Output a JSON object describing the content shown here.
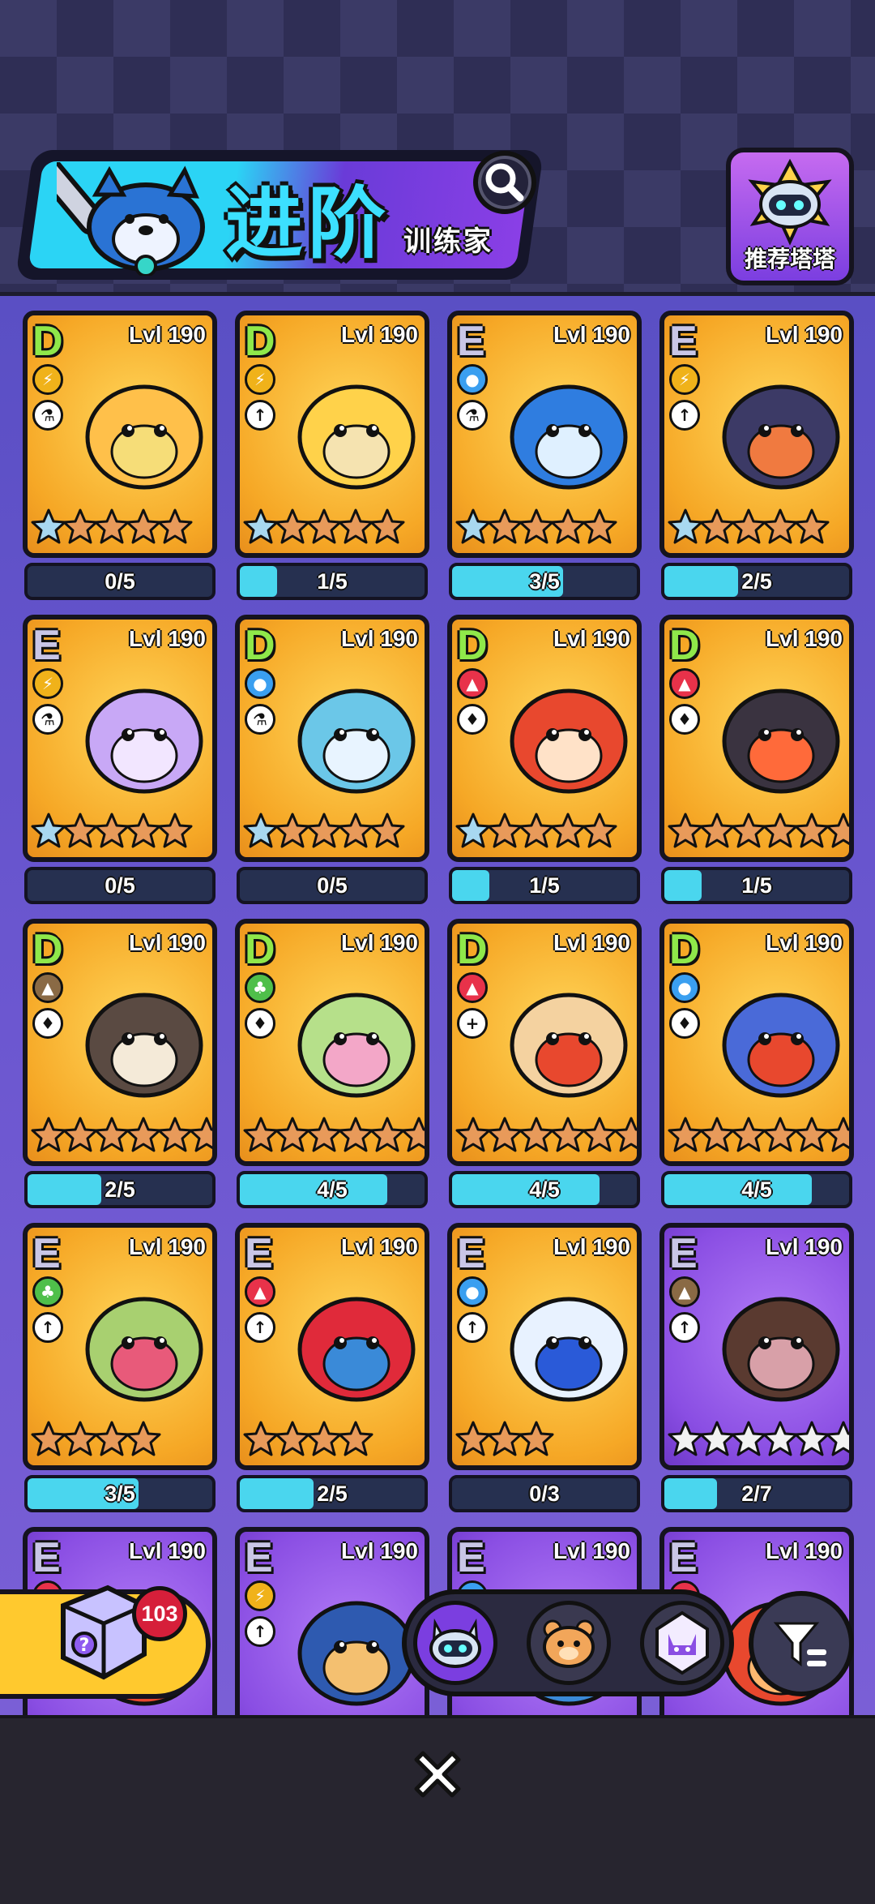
{
  "header": {
    "title": "进阶",
    "subtitle": "训练家",
    "recommend_label": "推荐塔塔"
  },
  "colors": {
    "card_gold": "#f6a826",
    "card_purple": "#8a4ee3",
    "progress_fill": "#4ad6ee",
    "grade_D": "#8fe84a",
    "grade_E": "#c9c6e6"
  },
  "cards": [
    {
      "grade": "D",
      "level": "Lvl 190",
      "element": "lightning",
      "role": "flask",
      "stars": 5,
      "silver": 1,
      "progress_label": "0/5",
      "progress": 0.0,
      "bg": "gold",
      "creature": "lion"
    },
    {
      "grade": "D",
      "level": "Lvl 190",
      "element": "lightning",
      "role": "runner",
      "stars": 5,
      "silver": 1,
      "progress_label": "1/5",
      "progress": 0.2,
      "bg": "gold",
      "creature": "bull"
    },
    {
      "grade": "E",
      "level": "Lvl 190",
      "element": "water",
      "role": "flask",
      "stars": 5,
      "silver": 1,
      "progress_label": "3/5",
      "progress": 0.6,
      "bg": "gold",
      "creature": "blue-bird"
    },
    {
      "grade": "E",
      "level": "Lvl 190",
      "element": "lightning",
      "role": "runner",
      "stars": 5,
      "silver": 1,
      "progress_label": "2/5",
      "progress": 0.4,
      "bg": "gold",
      "creature": "dark-dragon"
    },
    {
      "grade": "E",
      "level": "Lvl 190",
      "element": "lightning",
      "role": "flask",
      "stars": 5,
      "silver": 1,
      "progress_label": "0/5",
      "progress": 0.0,
      "bg": "gold",
      "creature": "purple-cat"
    },
    {
      "grade": "D",
      "level": "Lvl 190",
      "element": "water",
      "role": "flask",
      "stars": 5,
      "silver": 1,
      "progress_label": "0/5",
      "progress": 0.0,
      "bg": "gold",
      "creature": "butterfly-fox"
    },
    {
      "grade": "D",
      "level": "Lvl 190",
      "element": "fire",
      "role": "bell",
      "stars": 5,
      "silver": 1,
      "progress_label": "1/5",
      "progress": 0.2,
      "bg": "gold",
      "creature": "fire-toad"
    },
    {
      "grade": "D",
      "level": "Lvl 190",
      "element": "fire",
      "role": "bell",
      "stars": 6,
      "silver": 0,
      "progress_label": "1/5",
      "progress": 0.2,
      "bg": "gold",
      "creature": "raccoon"
    },
    {
      "grade": "D",
      "level": "Lvl 190",
      "element": "earth",
      "role": "bell",
      "stars": 6,
      "silver": 0,
      "progress_label": "2/5",
      "progress": 0.4,
      "bg": "gold",
      "creature": "dino"
    },
    {
      "grade": "D",
      "level": "Lvl 190",
      "element": "grass",
      "role": "bell",
      "stars": 6,
      "silver": 0,
      "progress_label": "4/5",
      "progress": 0.8,
      "bg": "gold",
      "creature": "mantis"
    },
    {
      "grade": "D",
      "level": "Lvl 190",
      "element": "fire",
      "role": "plus",
      "stars": 6,
      "silver": 0,
      "progress_label": "4/5",
      "progress": 0.8,
      "bg": "gold",
      "creature": "bunny"
    },
    {
      "grade": "D",
      "level": "Lvl 190",
      "element": "water",
      "role": "bell",
      "stars": 6,
      "silver": 0,
      "progress_label": "4/5",
      "progress": 0.8,
      "bg": "gold",
      "creature": "frog"
    },
    {
      "grade": "E",
      "level": "Lvl 190",
      "element": "grass",
      "role": "runner",
      "stars": 4,
      "silver": 0,
      "progress_label": "3/5",
      "progress": 0.6,
      "bg": "gold",
      "creature": "green-cat"
    },
    {
      "grade": "E",
      "level": "Lvl 190",
      "element": "fire",
      "role": "runner",
      "stars": 4,
      "silver": 0,
      "progress_label": "2/5",
      "progress": 0.4,
      "bg": "gold",
      "creature": "red-frog"
    },
    {
      "grade": "E",
      "level": "Lvl 190",
      "element": "water",
      "role": "runner",
      "stars": 3,
      "silver": 0,
      "progress_label": "0/3",
      "progress": 0.0,
      "bg": "gold",
      "creature": "snow-bird"
    },
    {
      "grade": "E",
      "level": "Lvl 190",
      "element": "earth",
      "role": "runner",
      "stars": 6,
      "silver": 6,
      "progress_label": "2/7",
      "progress": 0.2857,
      "bg": "purple",
      "creature": "boar"
    },
    {
      "grade": "E",
      "level": "Lvl 190",
      "element": "fire",
      "role": "",
      "stars": 0,
      "silver": 0,
      "progress_label": "",
      "progress": 0,
      "bg": "purple",
      "creature": "partial"
    },
    {
      "grade": "E",
      "level": "Lvl 190",
      "element": "lightning",
      "role": "runner",
      "stars": 0,
      "silver": 0,
      "progress_label": "",
      "progress": 0,
      "bg": "purple",
      "creature": "duck"
    },
    {
      "grade": "E",
      "level": "Lvl 190",
      "element": "water",
      "role": "",
      "stars": 0,
      "silver": 0,
      "progress_label": "",
      "progress": 0,
      "bg": "purple",
      "creature": "blue-hat"
    },
    {
      "grade": "E",
      "level": "Lvl 190",
      "element": "fire",
      "role": "",
      "stars": 0,
      "silver": 0,
      "progress_label": "",
      "progress": 0,
      "bg": "purple",
      "creature": "fire-beast"
    }
  ],
  "chest": {
    "count": "103"
  },
  "tabs": [
    "robot-cat-icon",
    "bear-face-icon",
    "purple-cat-crystal-icon"
  ],
  "filter_icon": "filter-icon",
  "close_icon": "close-icon"
}
